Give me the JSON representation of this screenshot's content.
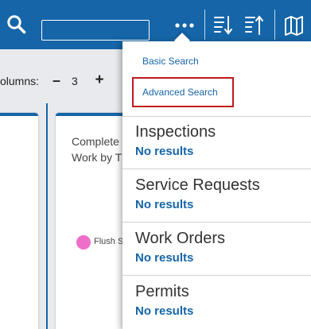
{
  "header": {
    "search_value": "",
    "icons": [
      "search-icon",
      "more-icon",
      "sort-descending-icon",
      "sort-ascending-icon",
      "map-icon"
    ]
  },
  "columns_control": {
    "label": "olumns:",
    "minus": "–",
    "value": "3",
    "plus": "+"
  },
  "cards": [
    {
      "title": "Complete\nWork by T",
      "legend": [
        {
          "label": "Flush S",
          "color": "#ee6fc9"
        }
      ]
    }
  ],
  "search_menu": {
    "basic_label": "Basic Search",
    "advanced_label": "Advanced Search",
    "sections": [
      {
        "title": "Inspections",
        "result": "No results"
      },
      {
        "title": "Service Requests",
        "result": "No results"
      },
      {
        "title": "Work Orders",
        "result": "No results"
      },
      {
        "title": "Permits",
        "result": "No results"
      }
    ]
  },
  "colors": {
    "primary": "#1565a8",
    "highlight": "#c0191f",
    "legend_pink": "#ee6fc9"
  }
}
